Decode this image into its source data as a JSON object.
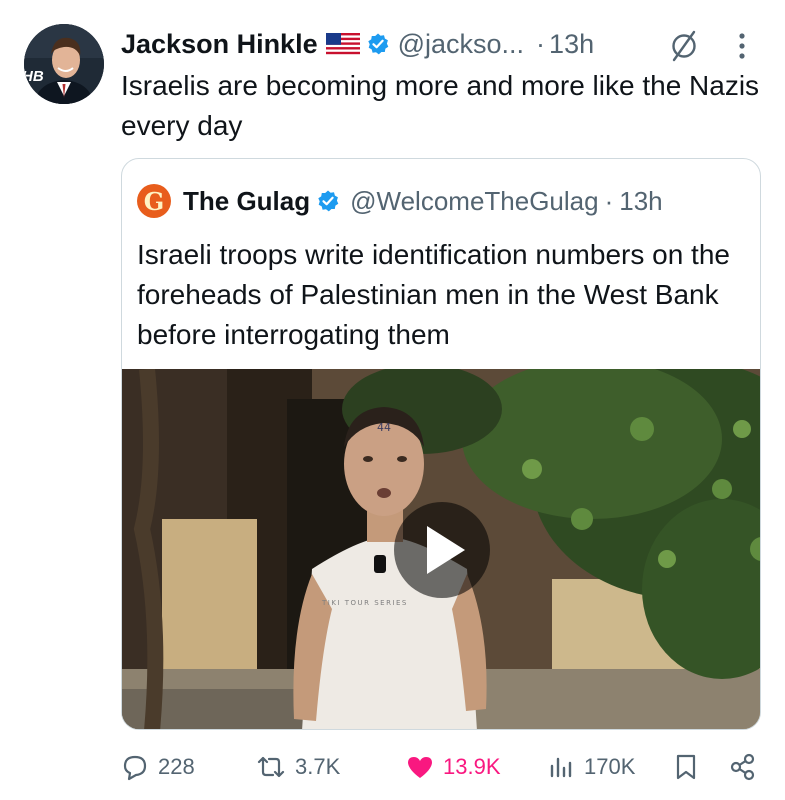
{
  "tweet": {
    "author_name": "Jackson Hinkle",
    "author_handle": "@jackso...",
    "separator": "·",
    "time": "13h",
    "avatar_badge": "HB",
    "text": "Israelis are becoming more and more like the Nazis every day"
  },
  "quoted": {
    "logo_letter": "G",
    "author_name": "The Gulag",
    "author_handle": "@WelcomeTheGulag",
    "separator": "·",
    "time": "13h",
    "text": "Israeli troops write identification numbers on the foreheads of Palestinian men in the West Bank before interrogating them",
    "media": {
      "forehead_number": "44",
      "shirt_text": "TIKI TOUR SERIES"
    }
  },
  "stats": {
    "replies": "228",
    "reposts": "3.7K",
    "likes": "13.9K",
    "views": "170K"
  },
  "icons": {
    "verified": "verified-badge-icon",
    "flag": "us-flag-icon",
    "grok": "grok-icon",
    "more": "more-icon",
    "reply": "reply-icon",
    "repost": "repost-icon",
    "like": "heart-icon",
    "views": "views-icon",
    "bookmark": "bookmark-icon",
    "share": "share-icon",
    "play": "play-icon"
  },
  "colors": {
    "verified": "#1d9bf0",
    "like": "#f91880",
    "secondary_text": "#536471",
    "gulag_logo": "#e85d1c"
  }
}
